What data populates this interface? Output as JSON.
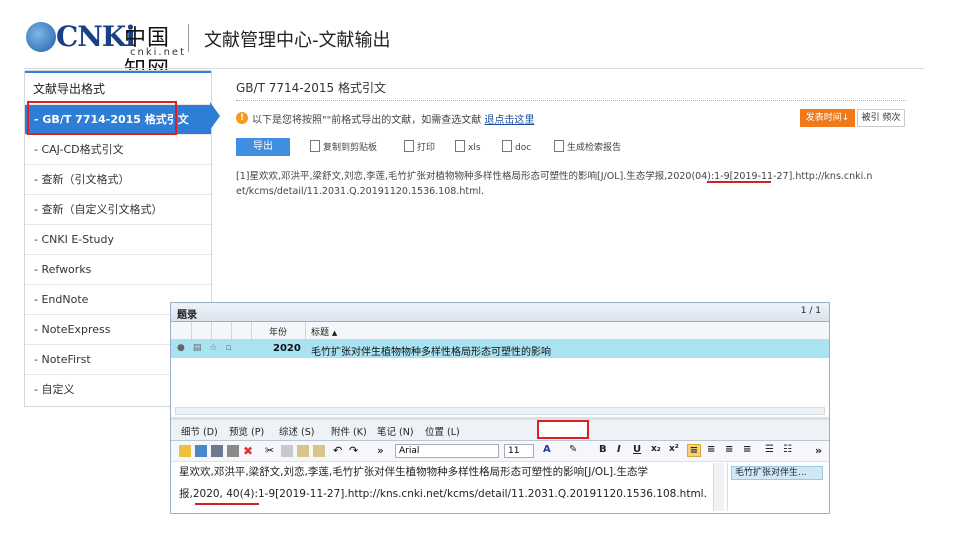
{
  "header": {
    "logo_text": "CNKi",
    "logo_cn": "中国知网",
    "logo_sub": "cnki.net",
    "page_title": "文献管理中心-文献输出"
  },
  "sidebar": {
    "title": "文献导出格式",
    "items": [
      {
        "label": "GB/T 7714-2015 格式引文",
        "active": true
      },
      {
        "label": "CAJ-CD格式引文"
      },
      {
        "label": "查新（引文格式）"
      },
      {
        "label": "查新（自定义引文格式）"
      },
      {
        "label": "CNKI E-Study"
      },
      {
        "label": "Refworks"
      },
      {
        "label": "EndNote"
      },
      {
        "label": "NoteExpress"
      },
      {
        "label": "NoteFirst"
      },
      {
        "label": "自定义"
      }
    ]
  },
  "main": {
    "title": "GB/T 7714-2015 格式引文",
    "info_text": "以下是您将按照\"\"前格式导出的文献，如需查选文献",
    "info_link": "退点击这里",
    "sort_button": "发表时间↓",
    "sort_button2": "被引 频次",
    "export_button": "导出",
    "tools": [
      "复制到剪贴板",
      "打印",
      "xls",
      "doc",
      "生成检索报告"
    ],
    "reference_line1": "[1]星欢欢,邓洪平,梁舒文,刘恋,李莲,毛竹扩张对植物物种多样性格局形态可塑性的影响[J/OL].生态学报,2020(04):1-9[2019-11-27].http://kns.cnki.n",
    "reference_line2": "et/kcms/detail/11.2031.Q.20191120.1536.108.html."
  },
  "client": {
    "title": "题录",
    "count": "1 / 1",
    "col_year": "年份",
    "col_title": "标题",
    "row_year": "2020",
    "row_title": "毛竹扩张对伴生植物物种多样性格局形态可塑性的影响",
    "tabs": [
      "细节 (D)",
      "预览 (P)",
      "综述 (S)",
      "附件 (K)",
      "笔记 (N)",
      "位置 (L)"
    ],
    "font_name": "Arial",
    "font_size": "11",
    "notes_line1": "星欢欢,邓洪平,梁舒文,刘恋,李莲,毛竹扩张对伴生植物物种多样性格局形态可塑性的影响[J/OL].生态学",
    "notes_line2": "报,2020, 40(4):1-9[2019-11-27].http://kns.cnki.net/kcms/detail/11.2031.Q.20191120.1536.108.html.",
    "side_item": "毛竹扩张对伴生..."
  },
  "colors": {
    "accent_blue": "#2d7ed4",
    "highlight_red": "#e02020",
    "orange": "#f07a1a",
    "row_highlight": "#a9e2f0"
  }
}
